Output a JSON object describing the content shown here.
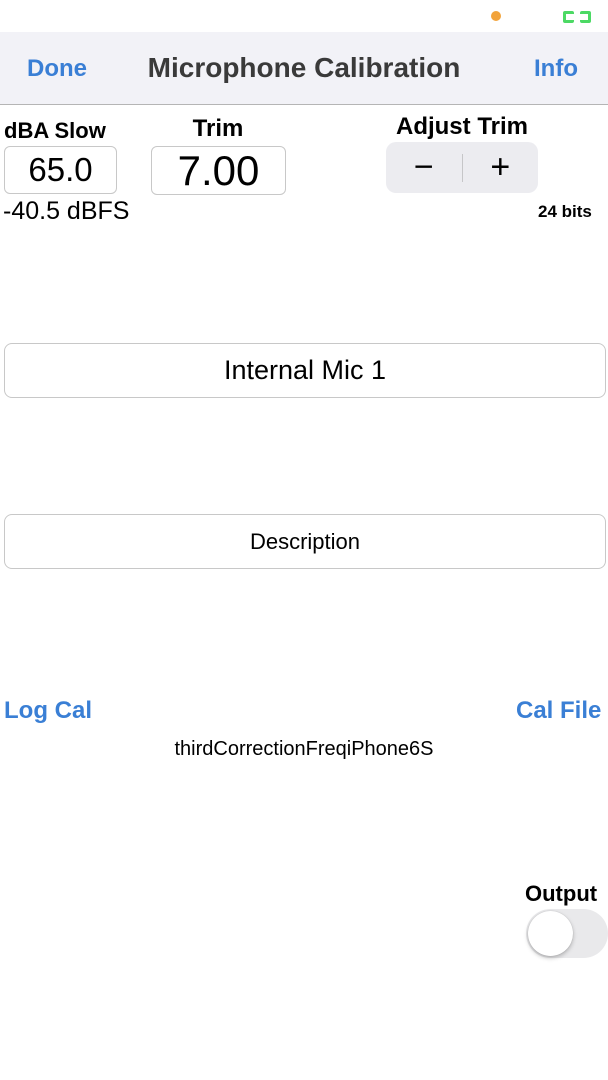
{
  "colors": {
    "accent": "#3a7fd5",
    "status_dot": "#f2a33a",
    "battery": "#4cd964"
  },
  "status_bar": {
    "icons": [
      "recording-dot-icon",
      "battery-icon"
    ]
  },
  "nav": {
    "left_button": "Done",
    "title": "Microphone Calibration",
    "right_button": "Info"
  },
  "readings": {
    "dba_label": "dBA Slow",
    "dba_value": "65.0",
    "dbfs_value": "-40.5 dBFS",
    "trim_label": "Trim",
    "trim_value": "7.00",
    "adjust_label": "Adjust Trim",
    "minus_symbol": "−",
    "plus_symbol": "+",
    "bits": "24 bits"
  },
  "fields": {
    "mic_name": "Internal Mic 1",
    "description": "Description"
  },
  "actions": {
    "log_cal": "Log Cal",
    "cal_file": "Cal File",
    "cal_file_name": "thirdCorrectionFreqiPhone6S"
  },
  "output": {
    "label": "Output",
    "enabled": false
  }
}
